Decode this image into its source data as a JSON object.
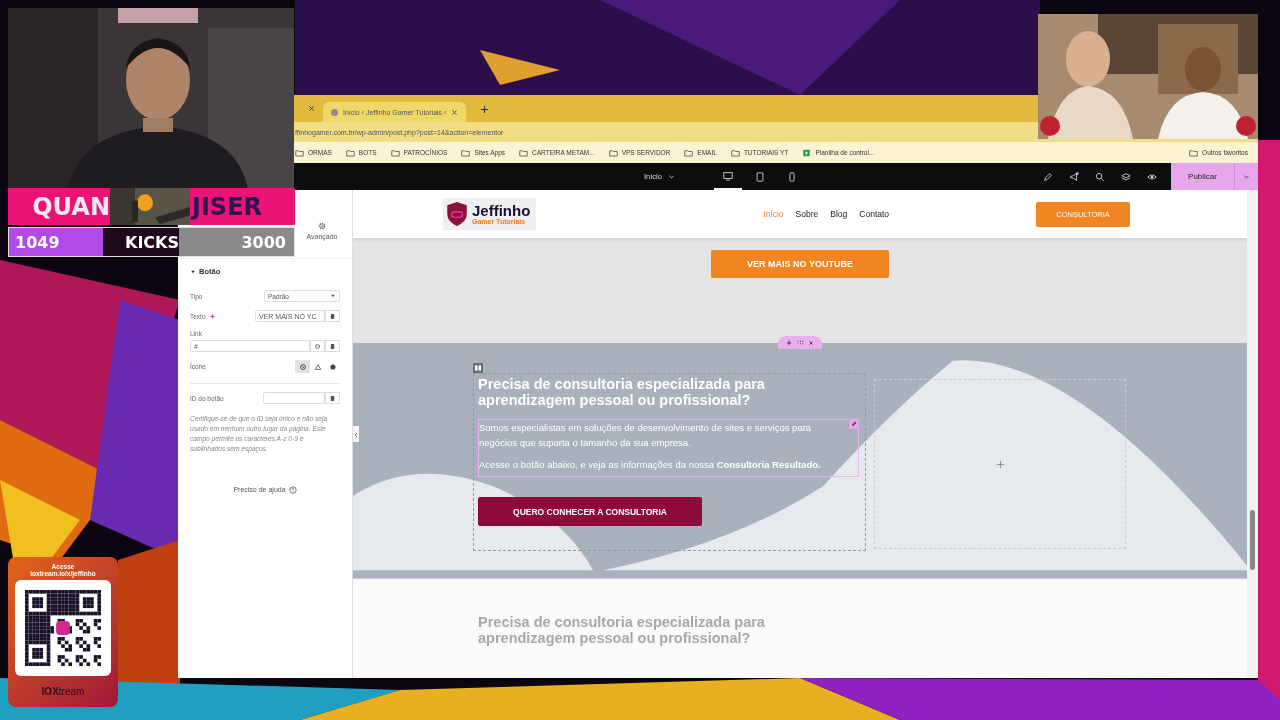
{
  "ticker": {
    "top_left": "QUAN",
    "top_right": "JISER",
    "count": "1049",
    "label": "KICKS",
    "goal": "3000"
  },
  "qr_card": {
    "line_1": "Acesse",
    "line_2": "ioxtream.io/x/jeffinho",
    "brand": "**IOX**tream"
  },
  "browser": {
    "tabs": [
      {
        "label": "Início ‹ Jeffinho Gamer Tutoriais ‹",
        "selected": true
      }
    ],
    "address": "ffinhogamer.com.br/wp-admin/post.php?post=14&action=elementor",
    "bookmarks": [
      {
        "kind": "folder",
        "label": "ORMAS"
      },
      {
        "kind": "folder",
        "label": "BOTS"
      },
      {
        "kind": "folder",
        "label": "PATROCÍNIOS"
      },
      {
        "kind": "folder",
        "label": "Sites Apps"
      },
      {
        "kind": "folder",
        "label": "CARTEIRA METAM..."
      },
      {
        "kind": "folder",
        "label": "VPS SERVIDOR"
      },
      {
        "kind": "folder",
        "label": "EMAIL"
      },
      {
        "kind": "folder",
        "label": "TUTORIAIS YT"
      },
      {
        "kind": "sheet",
        "label": "Planilha de control..."
      }
    ],
    "other_bookmarks": "Outros favoritos"
  },
  "editor_bar": {
    "page": "Início",
    "devices": [
      {
        "kind": "desktop",
        "selected": true
      },
      {
        "kind": "tablet",
        "selected": false
      },
      {
        "kind": "mobile",
        "selected": false
      }
    ],
    "publish": "Publicar"
  },
  "panel": {
    "tab": "Avançado",
    "section": "Botão",
    "fields": [
      {
        "kind": "select",
        "label": "Tipo",
        "value": "Padrão"
      },
      {
        "kind": "text",
        "label": "Texto",
        "value": "VER MAIS NO YC"
      },
      {
        "kind": "link",
        "label": "Link",
        "value": "#"
      },
      {
        "kind": "icons",
        "label": "Ícone",
        "options": [
          {
            "selected": true
          },
          {
            "selected": false
          },
          {
            "selected": false
          }
        ]
      },
      {
        "kind": "id",
        "label": "ID do botão"
      }
    ],
    "help_note": "Certifique-se de que o ID seja único e não seja usado em nenhum outro lugar da página. Este campo permite os caracteres A-z 0-9 e sublinhados sem espaços.",
    "help_link": "Preciso de ajuda"
  },
  "site": {
    "logo_title": "Jeffinho",
    "logo_subtitle": "Gamer Tutoriais",
    "nav": [
      {
        "label": "Início",
        "selected": true
      },
      {
        "label": "Sobre",
        "selected": false
      },
      {
        "label": "Blog",
        "selected": false
      },
      {
        "label": "Contato",
        "selected": false
      }
    ],
    "cta": "CONSULTORIA",
    "youtube_button": "VER MAIS NO YOUTUBE",
    "consult": {
      "heading": "Precisa de consultoria especializada para aprendizagem pessoal ou profissional?",
      "paragraph_1": "Somos especialistas em soluções de desenvolvimento de sites e serviços para negócios que suporta o tamanho da sua empresa.",
      "paragraph_2": "Acesse o botão abaixo, e veja as informações da nossa **Consultoria Resultado.**",
      "button": "QUERO CONHECER A CONSULTORIA"
    },
    "next_heading": "Precisa de consultoria especializada para aprendizagem pessoal ou profissional?"
  }
}
